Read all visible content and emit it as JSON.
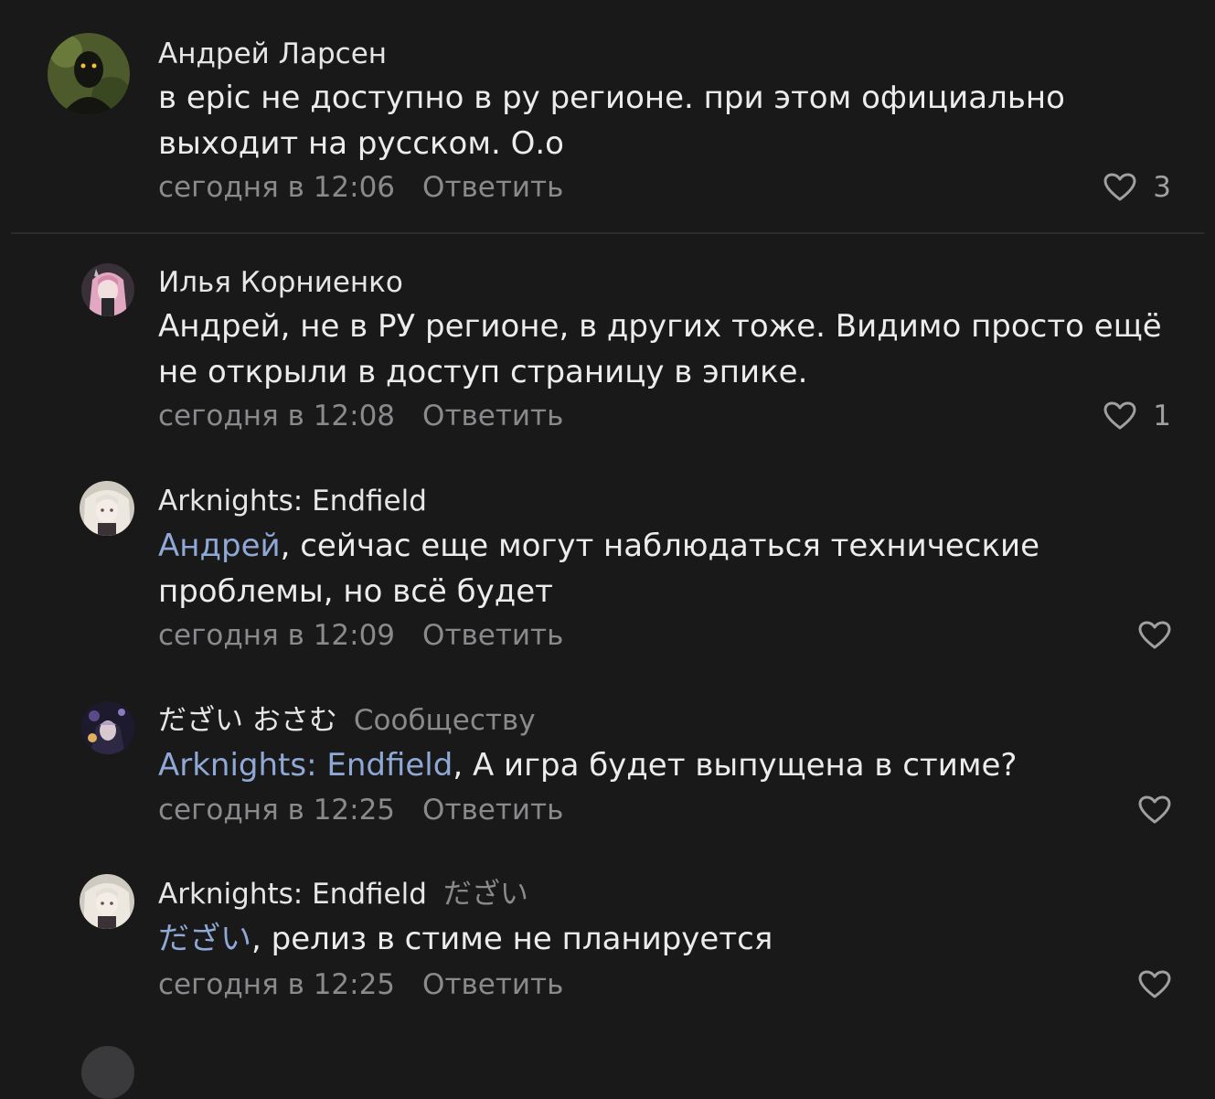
{
  "comments": [
    {
      "author": "Андрей Ларсен",
      "reply_to": "",
      "mention": "",
      "text": "в epic не доступно в ру регионе. при этом официально выходит на русском. О.о",
      "time": "сегодня в 12:06",
      "reply_label": "Ответить",
      "likes": "3"
    },
    {
      "author": "Илья Корниенко",
      "reply_to": "",
      "mention": "",
      "text": "Андрей, не в РУ регионе, в других тоже. Видимо просто ещё не открыли в доступ страницу в эпике.",
      "time": "сегодня в 12:08",
      "reply_label": "Ответить",
      "likes": "1"
    },
    {
      "author": "Arknights: Endfield",
      "reply_to": "",
      "mention": "Андрей",
      "text": ", сейчас еще могут наблюдаться технические проблемы, но всё будет",
      "time": "сегодня в 12:09",
      "reply_label": "Ответить",
      "likes": ""
    },
    {
      "author": "だざい おさむ",
      "reply_to": "Сообществу",
      "mention": "Arknights: Endfield",
      "text": ", А игра будет выпущена в стиме?",
      "time": "сегодня в 12:25",
      "reply_label": "Ответить",
      "likes": ""
    },
    {
      "author": "Arknights: Endfield",
      "reply_to": "だざい",
      "mention": "だざい",
      "text": ", релиз в стиме не планируется",
      "time": "сегодня в 12:25",
      "reply_label": "Ответить",
      "likes": ""
    }
  ],
  "icons": {
    "like": "heart-outline-icon"
  },
  "colors": {
    "background": "#19191a",
    "text": "#ececec",
    "muted": "#8a8a8c",
    "mention": "#8fa8d6"
  }
}
